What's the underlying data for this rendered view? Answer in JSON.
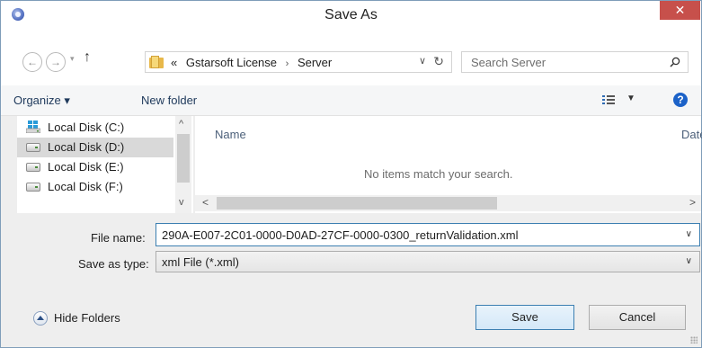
{
  "window": {
    "title": "Save As",
    "close_label": "✕"
  },
  "navigation": {
    "back_glyph": "←",
    "forward_glyph": "→",
    "recent_glyph": "▾",
    "up_glyph": "↑",
    "address": {
      "overflow": "«",
      "crumbs": [
        "Gstarsoft License",
        "Server"
      ],
      "separator": "›",
      "dropdown_glyph": "∨",
      "refresh_glyph": "↻"
    },
    "search": {
      "placeholder": "Search Server"
    }
  },
  "toolbar": {
    "organize_label": "Organize ▾",
    "new_folder_label": "New folder",
    "view_dropdown_glyph": "▼",
    "help_label": "?"
  },
  "navpane": {
    "items": [
      {
        "label": "Local Disk (C:)",
        "icon": "windows-drive-icon",
        "selected": false
      },
      {
        "label": "Local Disk (D:)",
        "icon": "drive-icon",
        "selected": true
      },
      {
        "label": "Local Disk (E:)",
        "icon": "drive-icon",
        "selected": false
      },
      {
        "label": "Local Disk (F:)",
        "icon": "drive-icon",
        "selected": false
      }
    ],
    "scroll_up_glyph": "^",
    "scroll_down_glyph": "v"
  },
  "filepane": {
    "columns": [
      "Name",
      "Date"
    ],
    "empty_message": "No items match your search.",
    "scroll_left_glyph": "<",
    "scroll_right_glyph": ">"
  },
  "form": {
    "file_name_label": "File name:",
    "file_name_value": "290A-E007-2C01-0000-D0AD-27CF-0000-0300_returnValidation.xml",
    "save_type_label": "Save as type:",
    "save_type_value": "xml File (*.xml)",
    "dropdown_glyph": "∨"
  },
  "footer": {
    "hide_folders_label": "Hide Folders",
    "save_label": "Save",
    "cancel_label": "Cancel"
  },
  "colors": {
    "close_button": "#c7504b",
    "accent_border": "#3c7fb1",
    "selection": "#d9d9d9",
    "link_text": "#1e395b"
  }
}
